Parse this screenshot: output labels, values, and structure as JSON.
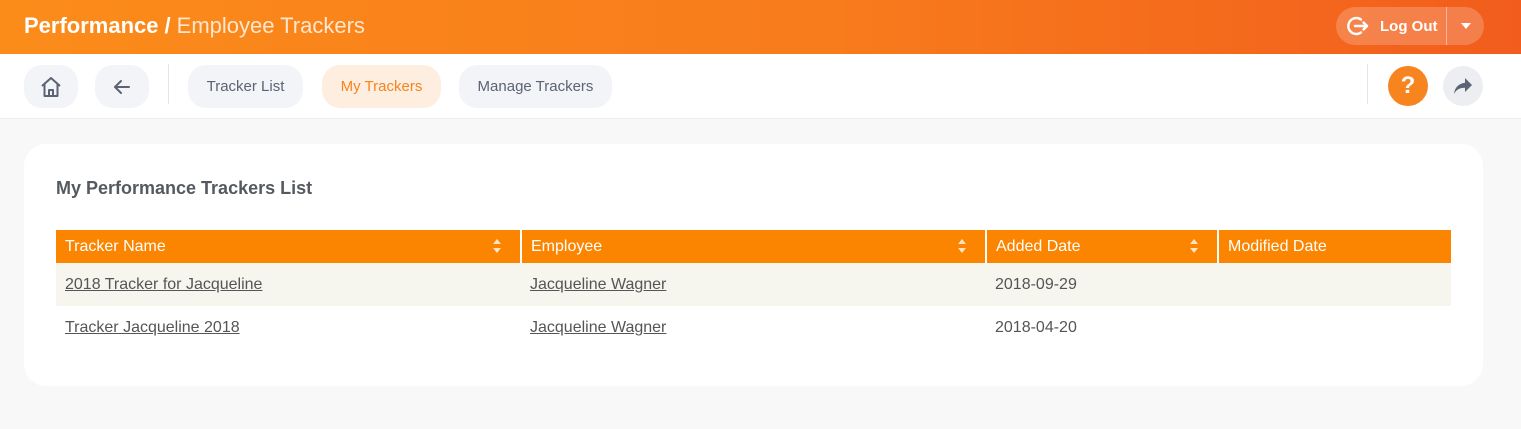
{
  "header": {
    "breadcrumb_root": "Performance",
    "breadcrumb_separator": "/",
    "breadcrumb_current": "Employee Trackers",
    "logout_label": "Log Out"
  },
  "toolbar": {
    "tabs": [
      {
        "label": "Tracker List",
        "active": false
      },
      {
        "label": "My Trackers",
        "active": true
      },
      {
        "label": "Manage Trackers",
        "active": false
      }
    ],
    "help_label": "?"
  },
  "colors": {
    "accent": "#f7841e",
    "table_header": "#fb8500"
  },
  "icons": [
    "home-icon",
    "back-arrow-icon",
    "logout-icon",
    "caret-down-icon",
    "help-icon",
    "share-icon",
    "sort-icon"
  ],
  "card": {
    "title": "My Performance Trackers List",
    "columns": [
      "Tracker Name",
      "Employee",
      "Added Date",
      "Modified Date"
    ],
    "rows": [
      {
        "tracker_name": "2018 Tracker for Jacqueline",
        "employee": "Jacqueline Wagner",
        "added_date": "2018-09-29",
        "modified_date": ""
      },
      {
        "tracker_name": "Tracker Jacqueline 2018",
        "employee": "Jacqueline Wagner",
        "added_date": "2018-04-20",
        "modified_date": ""
      }
    ]
  }
}
